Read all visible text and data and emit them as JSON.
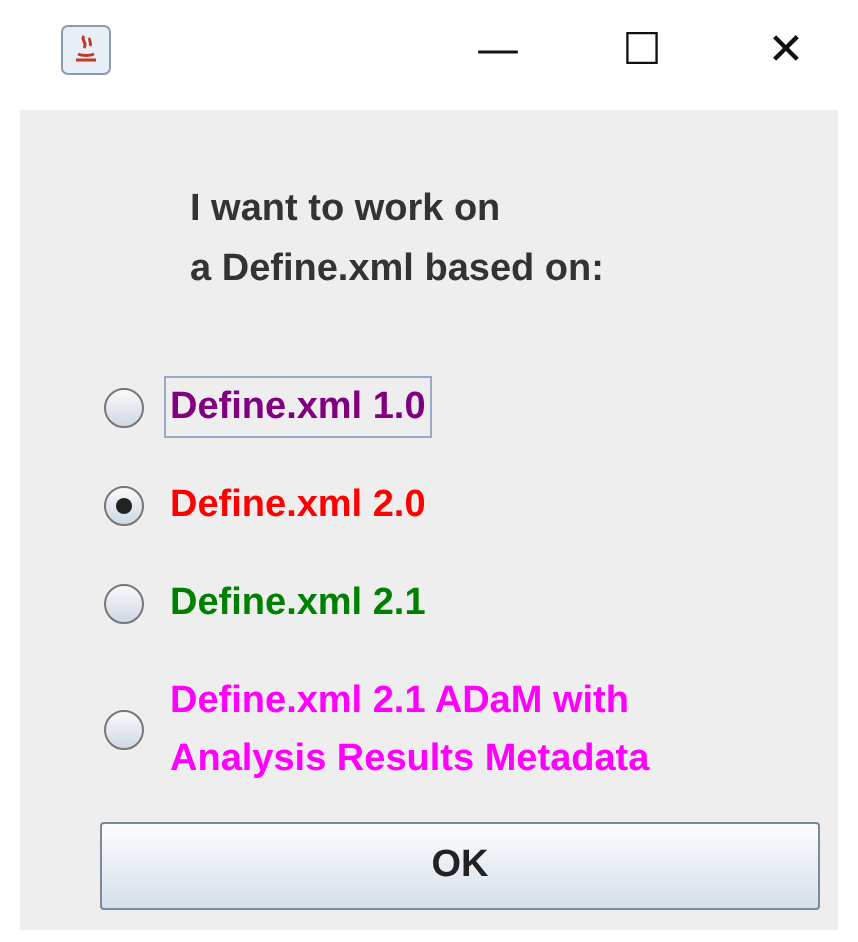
{
  "window": {
    "title_buttons": [
      "—",
      "☐",
      "✕"
    ]
  },
  "prompt": {
    "lines": [
      "I want to work on",
      "a Define.xml based on:"
    ]
  },
  "options": [
    {
      "label": "Define.xml 1.0",
      "selected": false,
      "focused": true,
      "color": "#800080"
    },
    {
      "label": "Define.xml 2.0",
      "selected": true,
      "focused": false,
      "color": "#ff0000"
    },
    {
      "label": "Define.xml 2.1",
      "selected": false,
      "focused": false,
      "color": "#008000"
    },
    {
      "label": "Define.xml 2.1 ADaM with\nAnalysis Results Metadata",
      "selected": false,
      "focused": false,
      "color": "#ff00ff"
    }
  ],
  "ok_button": {
    "label": "OK"
  }
}
